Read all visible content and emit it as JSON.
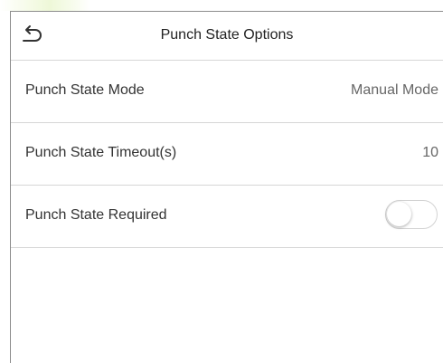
{
  "header": {
    "title": "Punch State Options",
    "back_icon": "back-arrow-icon"
  },
  "rows": [
    {
      "label": "Punch State Mode",
      "value": "Manual Mode"
    },
    {
      "label": "Punch State Timeout(s)",
      "value": "10"
    },
    {
      "label": "Punch State Required",
      "toggle_on": false
    }
  ],
  "colors": {
    "accent_tint": "#eef8d8",
    "divider": "#d6d6d6",
    "label_text": "#333333",
    "value_text": "#666666"
  }
}
